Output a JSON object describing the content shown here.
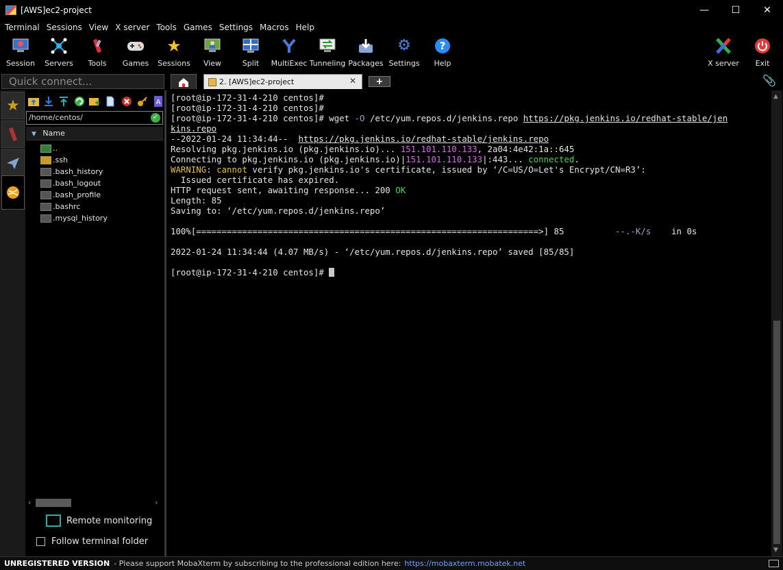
{
  "window": {
    "title": "[AWS]ec2-project",
    "controls": {
      "minimize": "—",
      "maximize": "☐",
      "close": "✕"
    }
  },
  "menu": [
    "Terminal",
    "Sessions",
    "View",
    "X server",
    "Tools",
    "Games",
    "Settings",
    "Macros",
    "Help"
  ],
  "toolbar": {
    "session": "Session",
    "servers": "Servers",
    "tools": "Tools",
    "games": "Games",
    "sessions": "Sessions",
    "view": "View",
    "split": "Split",
    "multiexec": "MultiExec",
    "tunneling": "Tunneling",
    "packages": "Packages",
    "settings": "Settings",
    "help": "Help",
    "xserver": "X server",
    "exit": "Exit"
  },
  "quick_connect": {
    "placeholder": "Quick connect..."
  },
  "tabs": {
    "active_label": "2. [AWS]ec2-project",
    "close": "✕",
    "new": "+"
  },
  "browser": {
    "path": "/home/centos/",
    "column_name": "Name",
    "files": [
      {
        "name": "..",
        "kind": "up"
      },
      {
        "name": ".ssh",
        "kind": "dir"
      },
      {
        "name": ".bash_history",
        "kind": "file"
      },
      {
        "name": ".bash_logout",
        "kind": "file"
      },
      {
        "name": ".bash_profile",
        "kind": "file"
      },
      {
        "name": ".bashrc",
        "kind": "file"
      },
      {
        "name": ".mysql_history",
        "kind": "file"
      }
    ],
    "remote_monitoring": "Remote monitoring",
    "follow_folder": "Follow terminal folder"
  },
  "terminal": {
    "prompt": "[root@ip-172-31-4-210 centos]#",
    "cmd_wget": "wget",
    "cmd_flag": "-O",
    "cmd_dest": "/etc/yum.repos.d/jenkins.repo",
    "url_part1": "https://pkg.jenkins.io/redhat-stable/jen",
    "url_part2": "kins.repo",
    "url_full": "https://pkg.jenkins.io/redhat-stable/jenkins.repo",
    "timestamp_line": "--2022-01-24 11:34:44--",
    "resolving_prefix": "Resolving pkg.jenkins.io (pkg.jenkins.io)...",
    "ip": "151.101.110.133",
    "resolving_suffix": ", 2a04:4e42:1a::645",
    "connecting_prefix": "Connecting to pkg.jenkins.io (pkg.jenkins.io)|",
    "connecting_mid": "|:443...",
    "connected": "connected",
    "warning_label": "WARNING",
    "cannot": "cannot",
    "warning_text": "verify pkg.jenkins.io's certificate, issued by ‘/C=US/O=Let's Encrypt/CN=R3’:",
    "expired": "  Issued certificate has expired.",
    "http_line": "HTTP request sent, awaiting response... 200",
    "ok": "OK",
    "length": "Length: 85",
    "saving": "Saving to: ‘/etc/yum.repos.d/jenkins.repo’",
    "progress_bar": "100%[===================================================================>] 85",
    "rate": "--.-K/s",
    "eta": "in 0s",
    "saved": "2022-01-24 11:34:44 (4.07 MB/s) - ‘/etc/yum.repos.d/jenkins.repo’ saved [85/85]"
  },
  "status": {
    "unregistered": "UNREGISTERED VERSION",
    "message": "-  Please support MobaXterm by subscribing to the professional edition here:",
    "link": "https://mobaxterm.mobatek.net"
  }
}
